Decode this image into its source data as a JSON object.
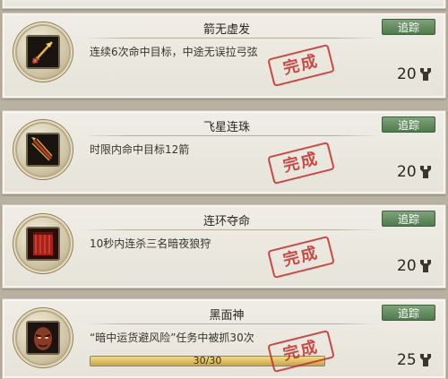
{
  "colors": {
    "stamp": "#c42d28",
    "track_button": "#5a8557",
    "progress_fill": "#d9bc5c"
  },
  "achievements": [
    {
      "title": "箭无虚发",
      "description": "连续6次命中目标，中途无误拉弓弦",
      "stamp": "完成",
      "track_label": "追踪",
      "reward": "20",
      "icon": "golden-arrow-icon"
    },
    {
      "title": "飞星连珠",
      "description": "时限内命中目标12箭",
      "stamp": "完成",
      "track_label": "追踪",
      "reward": "20",
      "icon": "arrow-bundle-icon"
    },
    {
      "title": "连环夺命",
      "description": "10秒内连杀三名暗夜狼狩",
      "stamp": "完成",
      "track_label": "追踪",
      "reward": "20",
      "icon": "red-banner-icon"
    },
    {
      "title": "黑面神",
      "description": "“暗中运货避风险”任务中被抓30次",
      "stamp": "完成",
      "track_label": "追踪",
      "reward": "25",
      "icon": "dark-face-icon",
      "progress": {
        "text": "30/30",
        "value": 1.0
      }
    }
  ]
}
